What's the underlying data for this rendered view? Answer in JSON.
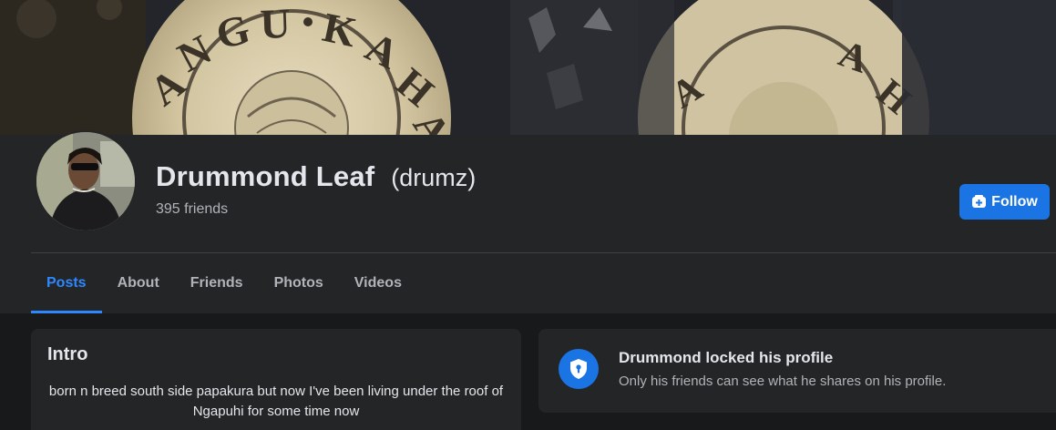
{
  "profile": {
    "name": "Drummond Leaf",
    "alternate_name": "(drumz)",
    "friends_count": "395 friends"
  },
  "actions": {
    "follow_label": "Follow",
    "follow_icon": "follow-plus-icon"
  },
  "tabs": [
    {
      "label": "Posts",
      "active": true
    },
    {
      "label": "About",
      "active": false
    },
    {
      "label": "Friends",
      "active": false
    },
    {
      "label": "Photos",
      "active": false
    },
    {
      "label": "Videos",
      "active": false
    }
  ],
  "intro": {
    "title": "Intro",
    "bio": "born n breed south side papakura but now I've been living under the roof of Ngapuhi for some time now"
  },
  "locked_notice": {
    "icon": "shield-lock-icon",
    "title": "Drummond locked his profile",
    "description": "Only his friends can see what he shares on his profile."
  },
  "colors": {
    "accent": "#2d88ff",
    "button": "#1b74e4",
    "surface": "#242526",
    "background": "#18191a"
  }
}
